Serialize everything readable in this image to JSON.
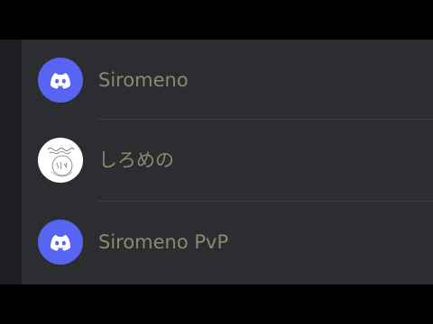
{
  "colors": {
    "background": "#2b2d31",
    "sidebar": "#1e1f22",
    "blurple": "#5865f2",
    "name_text": "#8a8a6e",
    "divider": "#3a3c42"
  },
  "list": {
    "items": [
      {
        "name": "Siromeno",
        "avatar_icon": "discord-logo-icon"
      },
      {
        "name": "しろめの",
        "avatar_icon": "sketch-avatar-icon"
      },
      {
        "name": "Siromeno PvP",
        "avatar_icon": "discord-logo-icon"
      }
    ]
  }
}
